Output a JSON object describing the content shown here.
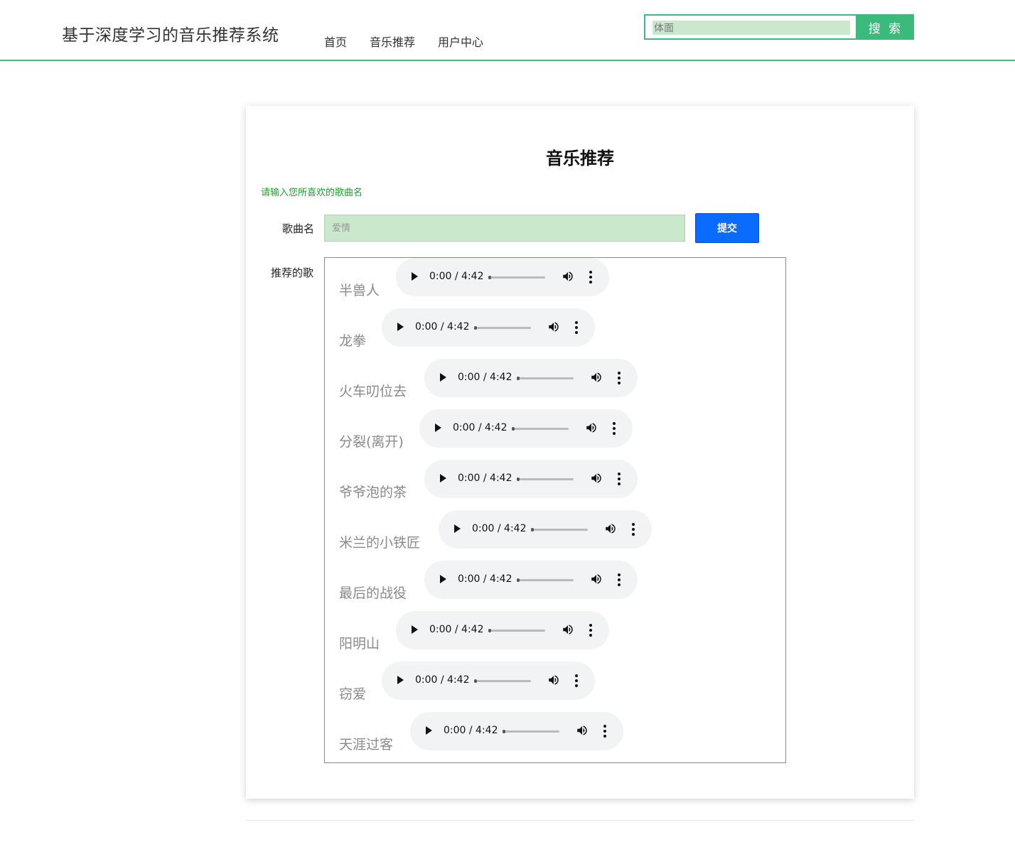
{
  "header": {
    "site_title": "基于深度学习的音乐推荐系统",
    "nav": [
      "首页",
      "音乐推荐",
      "用户中心"
    ],
    "search_value": "体面",
    "search_button": "搜 索"
  },
  "card": {
    "title": "音乐推荐",
    "hint": "请输入您所喜欢的歌曲名",
    "song_label": "歌曲名",
    "song_placeholder": "爱情",
    "submit_label": "提交",
    "recommend_label": "推荐的歌"
  },
  "songs": [
    {
      "name": "半兽人",
      "time": "0:00 / 4:42"
    },
    {
      "name": "龙拳",
      "time": "0:00 / 4:42"
    },
    {
      "name": "火车叨位去",
      "time": "0:00 / 4:42"
    },
    {
      "name": "分裂(离开)",
      "time": "0:00 / 4:42"
    },
    {
      "name": "爷爷泡的茶",
      "time": "0:00 / 4:42"
    },
    {
      "name": "米兰的小铁匠",
      "time": "0:00 / 4:42"
    },
    {
      "name": "最后的战役",
      "time": "0:00 / 4:42"
    },
    {
      "name": "阳明山",
      "time": "0:00 / 4:42"
    },
    {
      "name": "窃爱",
      "time": "0:00 / 4:42"
    },
    {
      "name": "天涯过客",
      "time": "0:00 / 4:42"
    }
  ],
  "colors": {
    "accent_green": "#3cb97d",
    "submit_blue": "#0a6cff",
    "hint_green": "#1f9d2f",
    "input_green": "#c9e8cc"
  },
  "icons": [
    "play-icon",
    "volume-icon",
    "more-vert-icon"
  ]
}
